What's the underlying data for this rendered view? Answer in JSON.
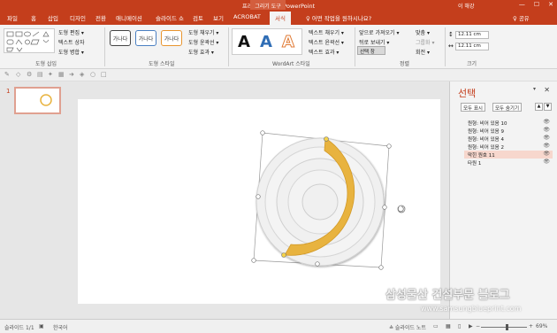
{
  "titlebar": {
    "title": "프레젠테이션2 - PowerPoint",
    "context_tab": "그리기 도구",
    "user": "이 해강",
    "min": "—",
    "max": "☐",
    "close": "✕"
  },
  "tabs": [
    {
      "label": "파일"
    },
    {
      "label": "홈"
    },
    {
      "label": "삽입"
    },
    {
      "label": "디자인"
    },
    {
      "label": "전환"
    },
    {
      "label": "애니메이션"
    },
    {
      "label": "슬라이드 쇼"
    },
    {
      "label": "검토"
    },
    {
      "label": "보기"
    },
    {
      "label": "ACROBAT"
    },
    {
      "label": "서식"
    }
  ],
  "tellme": "♀ 어떤 작업을 원하시나요?",
  "share": "♀ 공유",
  "ribbon": {
    "insert_shapes": {
      "edit_shape": "도형 편집 ▾",
      "text_box": "텍스트 상자",
      "merge_shapes": "도형 병합 ▾",
      "label": "도형 삽입"
    },
    "shape_styles": {
      "sample": "가나다",
      "fill": "도형 채우기 ▾",
      "outline": "도형 윤곽선 ▾",
      "effects": "도형 효과 ▾",
      "label": "도형 스타일"
    },
    "wordart": {
      "letter": "A",
      "text_fill": "텍스트 채우기 ▾",
      "text_outline": "텍스트 윤곽선 ▾",
      "text_effects": "텍스트 효과 ▾",
      "label": "WordArt 스타일"
    },
    "arrange": {
      "bring_forward": "앞으로 가져오기 ▾",
      "send_backward": "뒤로 보내기 ▾",
      "selection_pane": "선택 창",
      "align": "맞춤 ▾",
      "group": "그룹화 ▾",
      "rotate": "회전 ▾",
      "label": "정렬"
    },
    "size": {
      "height": "12.11 cm",
      "width": "12.11 cm",
      "label": "크기"
    }
  },
  "slides_panel": {
    "slide_number": "1"
  },
  "selection_pane": {
    "title": "선택",
    "show_all": "모두 표시",
    "hide_all": "모두 숨기기",
    "up": "▲",
    "down": "▼",
    "items": [
      {
        "label": "원형: 비어 있음 10",
        "selected": false
      },
      {
        "label": "원형: 비어 있음 9",
        "selected": false
      },
      {
        "label": "원형: 비어 있음 4",
        "selected": false
      },
      {
        "label": "원형: 비어 있음 2",
        "selected": false
      },
      {
        "label": "막힌 원호 11",
        "selected": true
      },
      {
        "label": "타원 1",
        "selected": false
      }
    ]
  },
  "status": {
    "slide": "슬라이드 1/1",
    "lang": "한국어",
    "notes": "≙ 슬라이드 노트",
    "zoom": "69%"
  },
  "watermark": {
    "title": "삼성물산 건설부문 블로그",
    "url": "www.samsungblueprint.com"
  },
  "colors": {
    "accent": "#c43e1c",
    "arc": "#e8b33f"
  }
}
